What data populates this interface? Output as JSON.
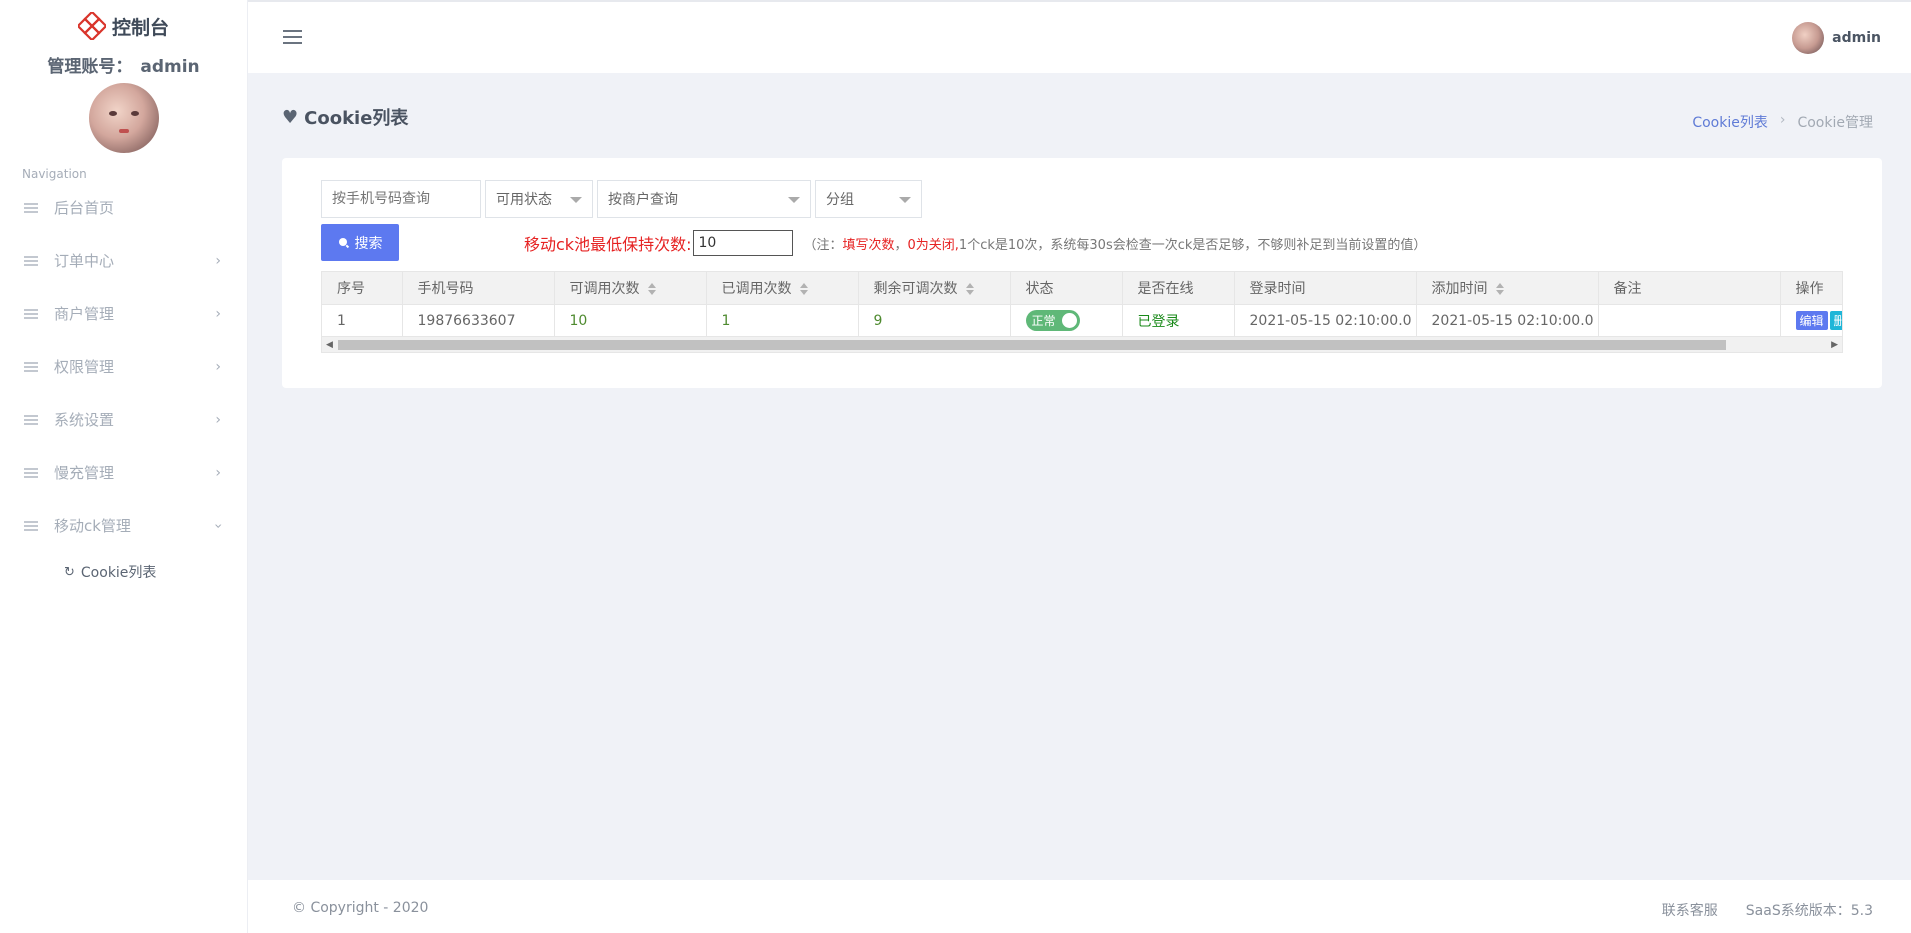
{
  "brand": {
    "title": "控制台"
  },
  "account": {
    "label": "管理账号：",
    "name": "admin"
  },
  "nav": {
    "title": "Navigation",
    "items": [
      {
        "label": "后台首页",
        "has_chevron": false
      },
      {
        "label": "订单中心",
        "has_chevron": true
      },
      {
        "label": "商户管理",
        "has_chevron": true
      },
      {
        "label": "权限管理",
        "has_chevron": true
      },
      {
        "label": "系统设置",
        "has_chevron": true
      },
      {
        "label": "慢充管理",
        "has_chevron": true
      },
      {
        "label": "移动ck管理",
        "has_chevron": true,
        "expanded": true
      }
    ],
    "sub_items": [
      {
        "label": "Cookie列表"
      }
    ]
  },
  "topbar": {
    "user": "admin"
  },
  "page": {
    "title": "Cookie列表",
    "breadcrumb": {
      "link": "Cookie列表",
      "separator": "›",
      "current": "Cookie管理"
    }
  },
  "filters": {
    "phone_placeholder": "按手机号码查询",
    "status": "可用状态",
    "merchant": "按商户查询",
    "group": "分组"
  },
  "search_button": "搜索",
  "notice": {
    "label": "移动ck池最低保持次数:",
    "value": "10",
    "note_prefix": "（注：",
    "note_red1": "填写次数",
    "note_comma": "，",
    "note_red2": "0为关闭,",
    "note_rest": "1个ck是10次，系统每30s会检查一次ck是否足够，不够则补足到当前设置的值）"
  },
  "table": {
    "columns": [
      "序号",
      "手机号码",
      "可调用次数",
      "已调用次数",
      "剩余可调次数",
      "状态",
      "是否在线",
      "登录时间",
      "添加时间",
      "备注",
      "操作"
    ],
    "rows": [
      {
        "index": "1",
        "phone": "19876633607",
        "callable": "10",
        "called": "1",
        "remaining": "9",
        "status": "正常",
        "online": "已登录",
        "login_time": "2021-05-15 02:10:00.0",
        "add_time": "2021-05-15 02:10:00.0",
        "remark": "",
        "actions": {
          "edit": "编辑",
          "delete": "删除"
        }
      }
    ]
  },
  "footer": {
    "copyright": "© Copyright - 2020",
    "contact": "联系客服",
    "version": "SaaS系统版本：5.3"
  },
  "colors": {
    "primary": "#5d79f0",
    "danger": "#e62222",
    "success": "#5fb878",
    "info": "#1fb6d8"
  }
}
